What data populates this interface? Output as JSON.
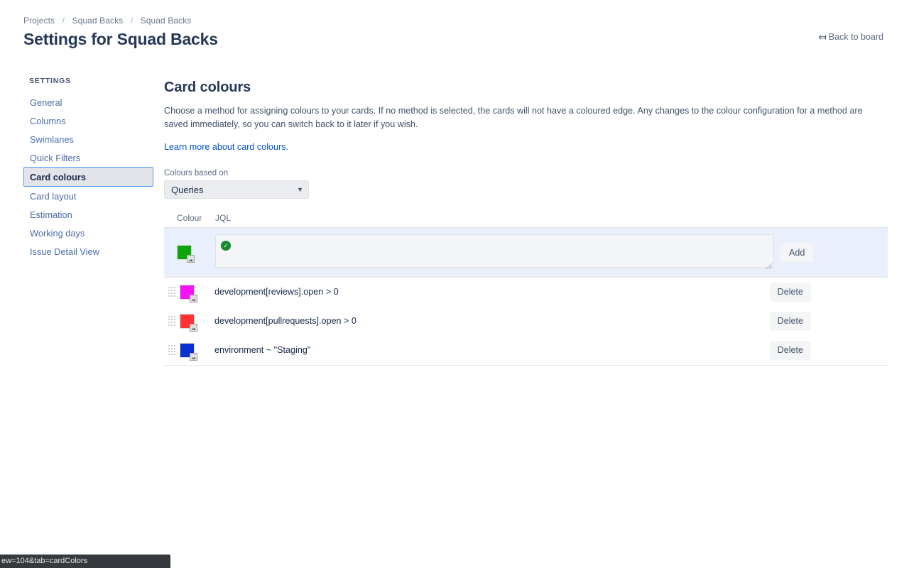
{
  "breadcrumb": {
    "items": [
      "Projects",
      "Squad Backs",
      "Squad Backs"
    ],
    "separator": "/"
  },
  "header": {
    "title": "Settings for Squad Backs",
    "back_label": "Back to board",
    "back_icon": "arrow-left-icon"
  },
  "sidebar": {
    "heading": "SETTINGS",
    "items": [
      {
        "label": "General",
        "selected": false
      },
      {
        "label": "Columns",
        "selected": false
      },
      {
        "label": "Swimlanes",
        "selected": false
      },
      {
        "label": "Quick Filters",
        "selected": false
      },
      {
        "label": "Card colours",
        "selected": true
      },
      {
        "label": "Card layout",
        "selected": false
      },
      {
        "label": "Estimation",
        "selected": false
      },
      {
        "label": "Working days",
        "selected": false
      },
      {
        "label": "Issue Detail View",
        "selected": false
      }
    ]
  },
  "main": {
    "section_title": "Card colours",
    "description": "Choose a method for assigning colours to your cards. If no method is selected, the cards will not have a coloured edge. Any changes to the colour configuration for a method are saved immediately, so you can switch back to it later if you wish.",
    "learn_more": "Learn more about card colours.",
    "select": {
      "label": "Colours based on",
      "value": "Queries",
      "caret_icon": "chevron-down-icon"
    },
    "table": {
      "headers": {
        "colour": "Colour",
        "jql": "JQL"
      },
      "add_row": {
        "swatch_color": "#0aa60a",
        "swatch_icon": "colour-picker-icon",
        "validation_icon": "check-circle-icon",
        "jql_value": "",
        "jql_placeholder": "",
        "add_label": "Add"
      },
      "rows": [
        {
          "drag_icon": "drag-handle-icon",
          "swatch_color": "#f612f6",
          "jql": "development[reviews].open > 0",
          "delete_label": "Delete"
        },
        {
          "drag_icon": "drag-handle-icon",
          "swatch_color": "#ff3333",
          "jql": "development[pullrequests].open > 0",
          "delete_label": "Delete"
        },
        {
          "drag_icon": "drag-handle-icon",
          "swatch_color": "#0a2fd0",
          "jql": "environment ~ \"Staging\"",
          "delete_label": "Delete"
        }
      ]
    }
  },
  "statusbar": {
    "text": "ew=104&tab=cardColors"
  },
  "colors": {
    "accent_link": "#0052cc",
    "selected_border": "#4c9aff",
    "addrow_bg": "#e9f0fb",
    "valid_green": "#14892c"
  }
}
